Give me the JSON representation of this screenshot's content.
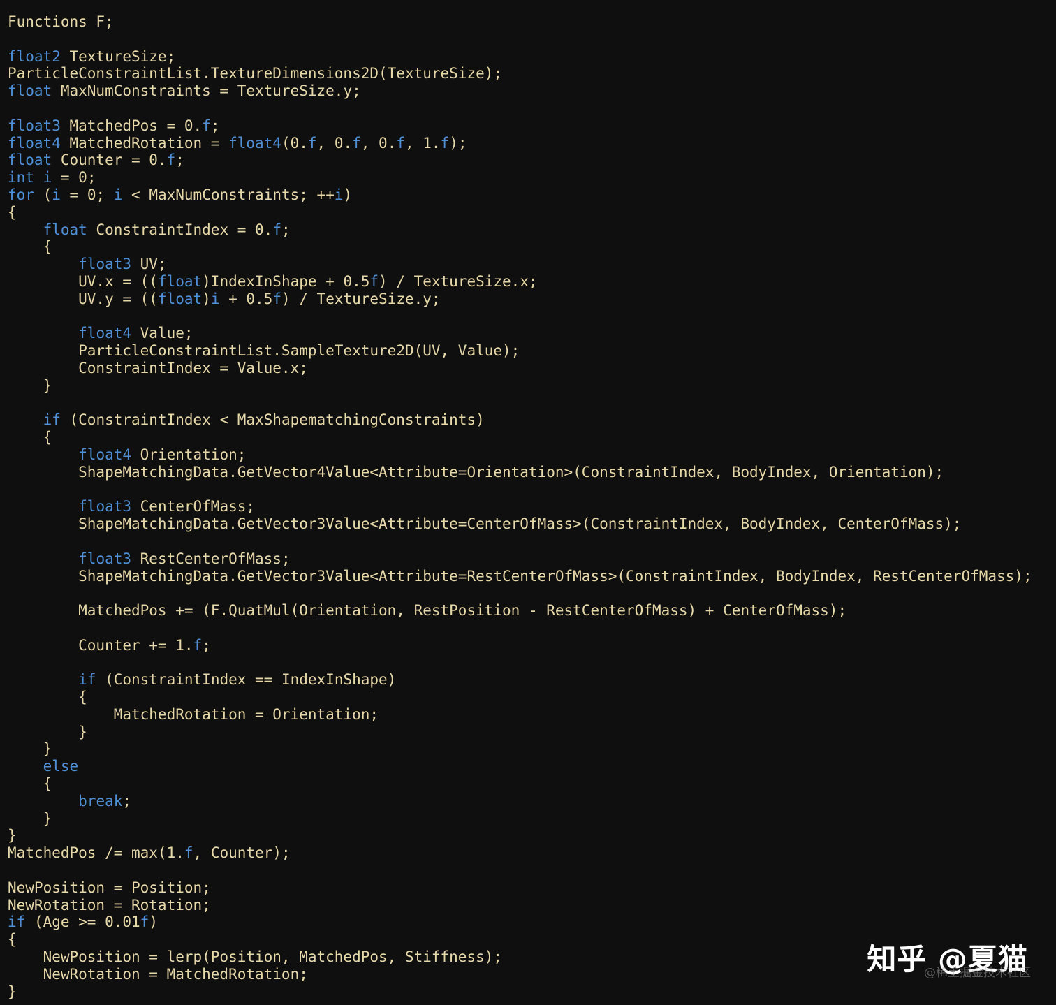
{
  "code": {
    "lines": [
      [
        {
          "t": "Functions F;",
          "c": "id"
        }
      ],
      [],
      [
        {
          "t": "float2",
          "c": "kw"
        },
        {
          "t": " TextureSize;",
          "c": "id"
        }
      ],
      [
        {
          "t": "ParticleConstraintList.TextureDimensions2D(TextureSize);",
          "c": "id"
        }
      ],
      [
        {
          "t": "float",
          "c": "kw"
        },
        {
          "t": " MaxNumConstraints = TextureSize.y;",
          "c": "id"
        }
      ],
      [],
      [
        {
          "t": "float3",
          "c": "kw"
        },
        {
          "t": " MatchedPos = 0.",
          "c": "id"
        },
        {
          "t": "f",
          "c": "kw"
        },
        {
          "t": ";",
          "c": "id"
        }
      ],
      [
        {
          "t": "float4",
          "c": "kw"
        },
        {
          "t": " MatchedRotation = ",
          "c": "id"
        },
        {
          "t": "float4",
          "c": "kw"
        },
        {
          "t": "(0.",
          "c": "id"
        },
        {
          "t": "f",
          "c": "kw"
        },
        {
          "t": ", 0.",
          "c": "id"
        },
        {
          "t": "f",
          "c": "kw"
        },
        {
          "t": ", 0.",
          "c": "id"
        },
        {
          "t": "f",
          "c": "kw"
        },
        {
          "t": ", 1.",
          "c": "id"
        },
        {
          "t": "f",
          "c": "kw"
        },
        {
          "t": ");",
          "c": "id"
        }
      ],
      [
        {
          "t": "float",
          "c": "kw"
        },
        {
          "t": " Counter = 0.",
          "c": "id"
        },
        {
          "t": "f",
          "c": "kw"
        },
        {
          "t": ";",
          "c": "id"
        }
      ],
      [
        {
          "t": "int",
          "c": "kw"
        },
        {
          "t": " ",
          "c": "id"
        },
        {
          "t": "i",
          "c": "kw"
        },
        {
          "t": " = 0;",
          "c": "id"
        }
      ],
      [
        {
          "t": "for",
          "c": "kw"
        },
        {
          "t": " (",
          "c": "id"
        },
        {
          "t": "i",
          "c": "kw"
        },
        {
          "t": " = 0; ",
          "c": "id"
        },
        {
          "t": "i",
          "c": "kw"
        },
        {
          "t": " < MaxNumConstraints; ++",
          "c": "id"
        },
        {
          "t": "i",
          "c": "kw"
        },
        {
          "t": ")",
          "c": "id"
        }
      ],
      [
        {
          "t": "{",
          "c": "id"
        }
      ],
      [
        {
          "t": "    ",
          "c": "id"
        },
        {
          "t": "float",
          "c": "kw"
        },
        {
          "t": " ConstraintIndex = 0.",
          "c": "id"
        },
        {
          "t": "f",
          "c": "kw"
        },
        {
          "t": ";",
          "c": "id"
        }
      ],
      [
        {
          "t": "    {",
          "c": "id"
        }
      ],
      [
        {
          "t": "        ",
          "c": "id"
        },
        {
          "t": "float3",
          "c": "kw"
        },
        {
          "t": " UV;",
          "c": "id"
        }
      ],
      [
        {
          "t": "        UV.x = ((",
          "c": "id"
        },
        {
          "t": "float",
          "c": "kw"
        },
        {
          "t": ")IndexInShape + 0.5",
          "c": "id"
        },
        {
          "t": "f",
          "c": "kw"
        },
        {
          "t": ") / TextureSize.x;",
          "c": "id"
        }
      ],
      [
        {
          "t": "        UV.y = ((",
          "c": "id"
        },
        {
          "t": "float",
          "c": "kw"
        },
        {
          "t": ")",
          "c": "id"
        },
        {
          "t": "i",
          "c": "kw"
        },
        {
          "t": " + 0.5",
          "c": "id"
        },
        {
          "t": "f",
          "c": "kw"
        },
        {
          "t": ") / TextureSize.y;",
          "c": "id"
        }
      ],
      [],
      [
        {
          "t": "        ",
          "c": "id"
        },
        {
          "t": "float4",
          "c": "kw"
        },
        {
          "t": " Value;",
          "c": "id"
        }
      ],
      [
        {
          "t": "        ParticleConstraintList.SampleTexture2D(UV, Value);",
          "c": "id"
        }
      ],
      [
        {
          "t": "        ConstraintIndex = Value.x;",
          "c": "id"
        }
      ],
      [
        {
          "t": "    }",
          "c": "id"
        }
      ],
      [],
      [
        {
          "t": "    ",
          "c": "id"
        },
        {
          "t": "if",
          "c": "kw"
        },
        {
          "t": " (ConstraintIndex < MaxShapematchingConstraints)",
          "c": "id"
        }
      ],
      [
        {
          "t": "    {",
          "c": "id"
        }
      ],
      [
        {
          "t": "        ",
          "c": "id"
        },
        {
          "t": "float4",
          "c": "kw"
        },
        {
          "t": " Orientation;",
          "c": "id"
        }
      ],
      [
        {
          "t": "        ShapeMatchingData.GetVector4Value<Attribute=Orientation>(ConstraintIndex, BodyIndex, Orientation);",
          "c": "id"
        }
      ],
      [],
      [
        {
          "t": "        ",
          "c": "id"
        },
        {
          "t": "float3",
          "c": "kw"
        },
        {
          "t": " CenterOfMass;",
          "c": "id"
        }
      ],
      [
        {
          "t": "        ShapeMatchingData.GetVector3Value<Attribute=CenterOfMass>(ConstraintIndex, BodyIndex, CenterOfMass);",
          "c": "id"
        }
      ],
      [],
      [
        {
          "t": "        ",
          "c": "id"
        },
        {
          "t": "float3",
          "c": "kw"
        },
        {
          "t": " RestCenterOfMass;",
          "c": "id"
        }
      ],
      [
        {
          "t": "        ShapeMatchingData.GetVector3Value<Attribute=RestCenterOfMass>(ConstraintIndex, BodyIndex, RestCenterOfMass);",
          "c": "id"
        }
      ],
      [],
      [
        {
          "t": "        MatchedPos += (F.QuatMul(Orientation, RestPosition - RestCenterOfMass) + CenterOfMass);",
          "c": "id"
        }
      ],
      [],
      [
        {
          "t": "        Counter += 1.",
          "c": "id"
        },
        {
          "t": "f",
          "c": "kw"
        },
        {
          "t": ";",
          "c": "id"
        }
      ],
      [],
      [
        {
          "t": "        ",
          "c": "id"
        },
        {
          "t": "if",
          "c": "kw"
        },
        {
          "t": " (ConstraintIndex == IndexInShape)",
          "c": "id"
        }
      ],
      [
        {
          "t": "        {",
          "c": "id"
        }
      ],
      [
        {
          "t": "            MatchedRotation = Orientation;",
          "c": "id"
        }
      ],
      [
        {
          "t": "        }",
          "c": "id"
        }
      ],
      [
        {
          "t": "    }",
          "c": "id"
        }
      ],
      [
        {
          "t": "    ",
          "c": "id"
        },
        {
          "t": "else",
          "c": "kw"
        }
      ],
      [
        {
          "t": "    {",
          "c": "id"
        }
      ],
      [
        {
          "t": "        ",
          "c": "id"
        },
        {
          "t": "break",
          "c": "kw"
        },
        {
          "t": ";",
          "c": "id"
        }
      ],
      [
        {
          "t": "    }",
          "c": "id"
        }
      ],
      [
        {
          "t": "}",
          "c": "id"
        }
      ],
      [
        {
          "t": "MatchedPos /= max(1.",
          "c": "id"
        },
        {
          "t": "f",
          "c": "kw"
        },
        {
          "t": ", Counter);",
          "c": "id"
        }
      ],
      [],
      [
        {
          "t": "NewPosition = Position;",
          "c": "id"
        }
      ],
      [
        {
          "t": "NewRotation = Rotation;",
          "c": "id"
        }
      ],
      [
        {
          "t": "if",
          "c": "kw"
        },
        {
          "t": " (Age >= 0.01",
          "c": "id"
        },
        {
          "t": "f",
          "c": "kw"
        },
        {
          "t": ")",
          "c": "id"
        }
      ],
      [
        {
          "t": "{",
          "c": "id"
        }
      ],
      [
        {
          "t": "    NewPosition = lerp(Position, MatchedPos, Stiffness);",
          "c": "id"
        }
      ],
      [
        {
          "t": "    NewRotation = MatchedRotation;",
          "c": "id"
        }
      ],
      [
        {
          "t": "}",
          "c": "id"
        }
      ]
    ]
  },
  "watermark": {
    "main": "知乎 @夏猫",
    "sub": "@稀土掘金技术社区"
  },
  "colors": {
    "background": "#0f0f0f",
    "text": "#e6d8a8",
    "keyword": "#4f8fd6"
  }
}
